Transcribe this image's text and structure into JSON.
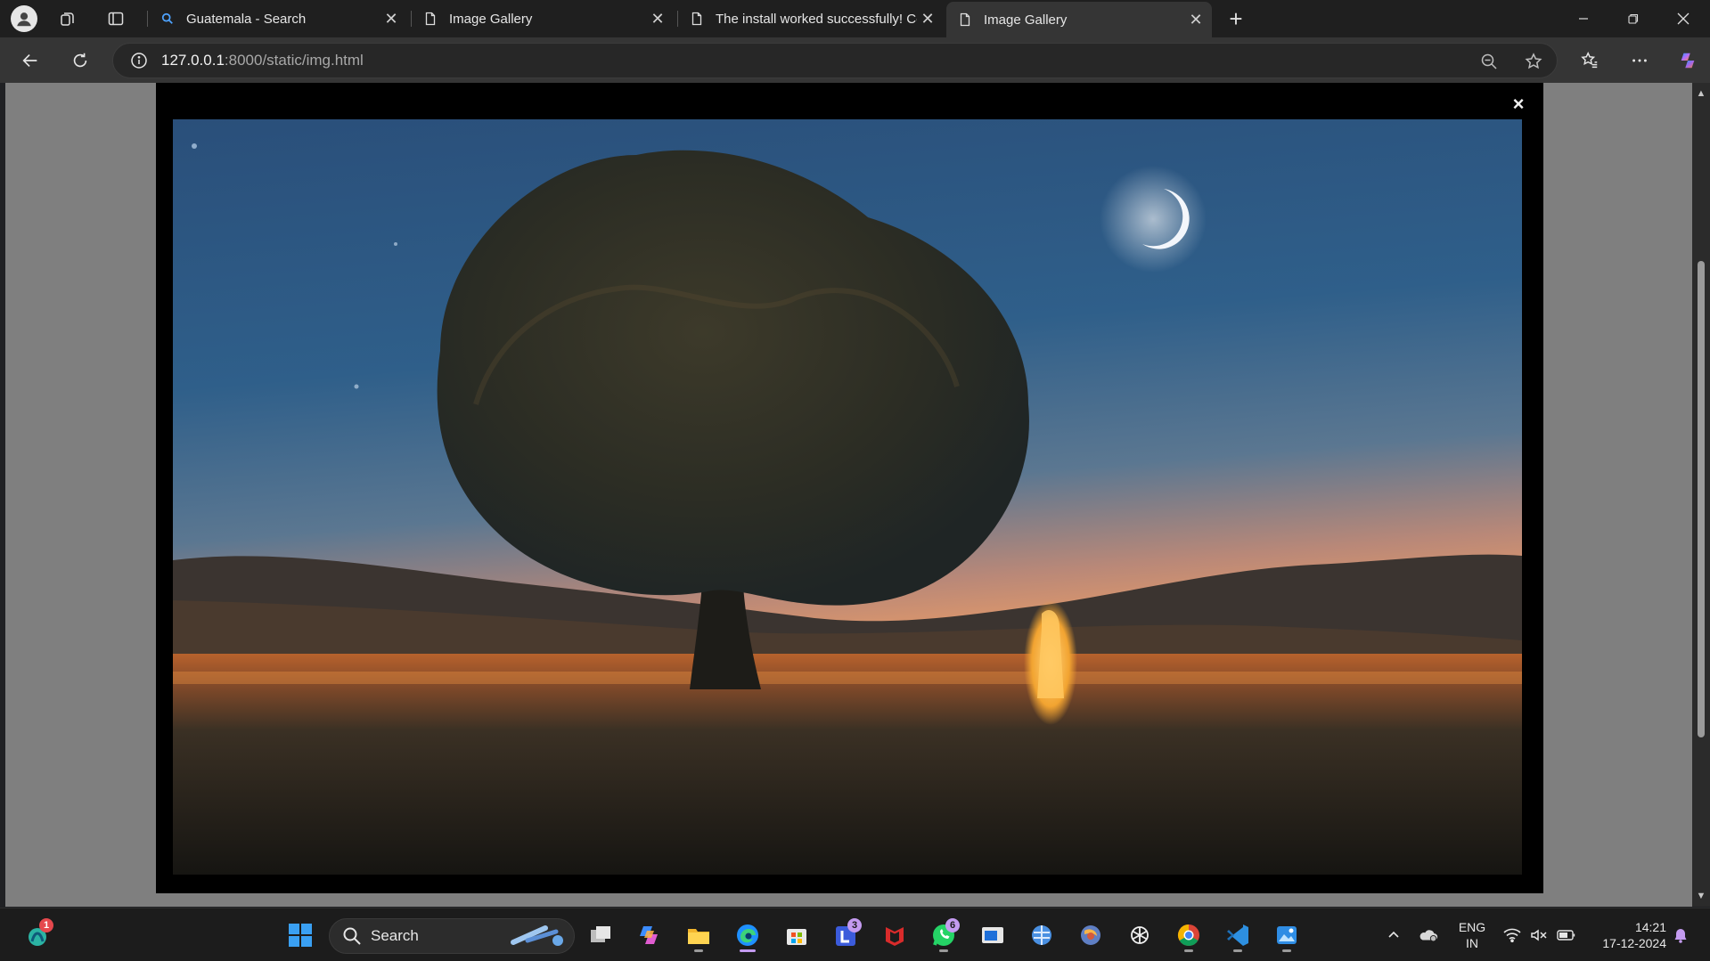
{
  "browser": {
    "tabs": [
      {
        "title": "Guatemala - Search",
        "icon": "search-icon",
        "active": false
      },
      {
        "title": "Image Gallery",
        "icon": "page-icon",
        "active": false
      },
      {
        "title": "The install worked successfully! Co",
        "icon": "page-icon",
        "active": false
      },
      {
        "title": "Image Gallery",
        "icon": "page-icon",
        "active": true
      }
    ],
    "new_tab_label": "+",
    "address": {
      "host": "127.0.0.1",
      "rest": ":8000/static/img.html"
    },
    "window_controls": {
      "minimize": "—",
      "restore": "❐",
      "close": "✕"
    }
  },
  "page": {
    "close_label": "×",
    "photo_icon": "moonlit-tree-landscape-image"
  },
  "taskbar": {
    "search_label": "Search",
    "badges": {
      "copilot_widget": "1",
      "teams": "3",
      "whatsapp": "6"
    },
    "language": {
      "line1": "ENG",
      "line2": "IN"
    },
    "clock": {
      "time": "14:21",
      "date": "17-12-2024"
    }
  },
  "colors": {
    "accent": "#c49bf0",
    "edge_blue": "#1e90ff",
    "vscode_blue": "#2d8fe0"
  }
}
